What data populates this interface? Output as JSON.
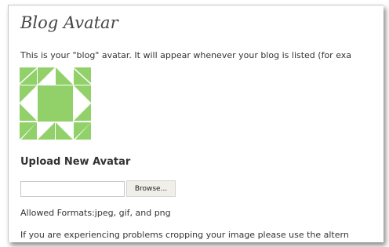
{
  "page": {
    "title": "Blog Avatar",
    "intro": "This is your \"blog\" avatar. It will appear whenever your blog is listed (for exa",
    "avatar_color": "#92d16a",
    "upload_heading": "Upload New Avatar",
    "file_input_value": "",
    "browse_label": "Browse...",
    "allowed_formats": "Allowed Formats:jpeg, gif, and png",
    "problems_text": "If you are experiencing problems cropping your image please use the altern"
  }
}
